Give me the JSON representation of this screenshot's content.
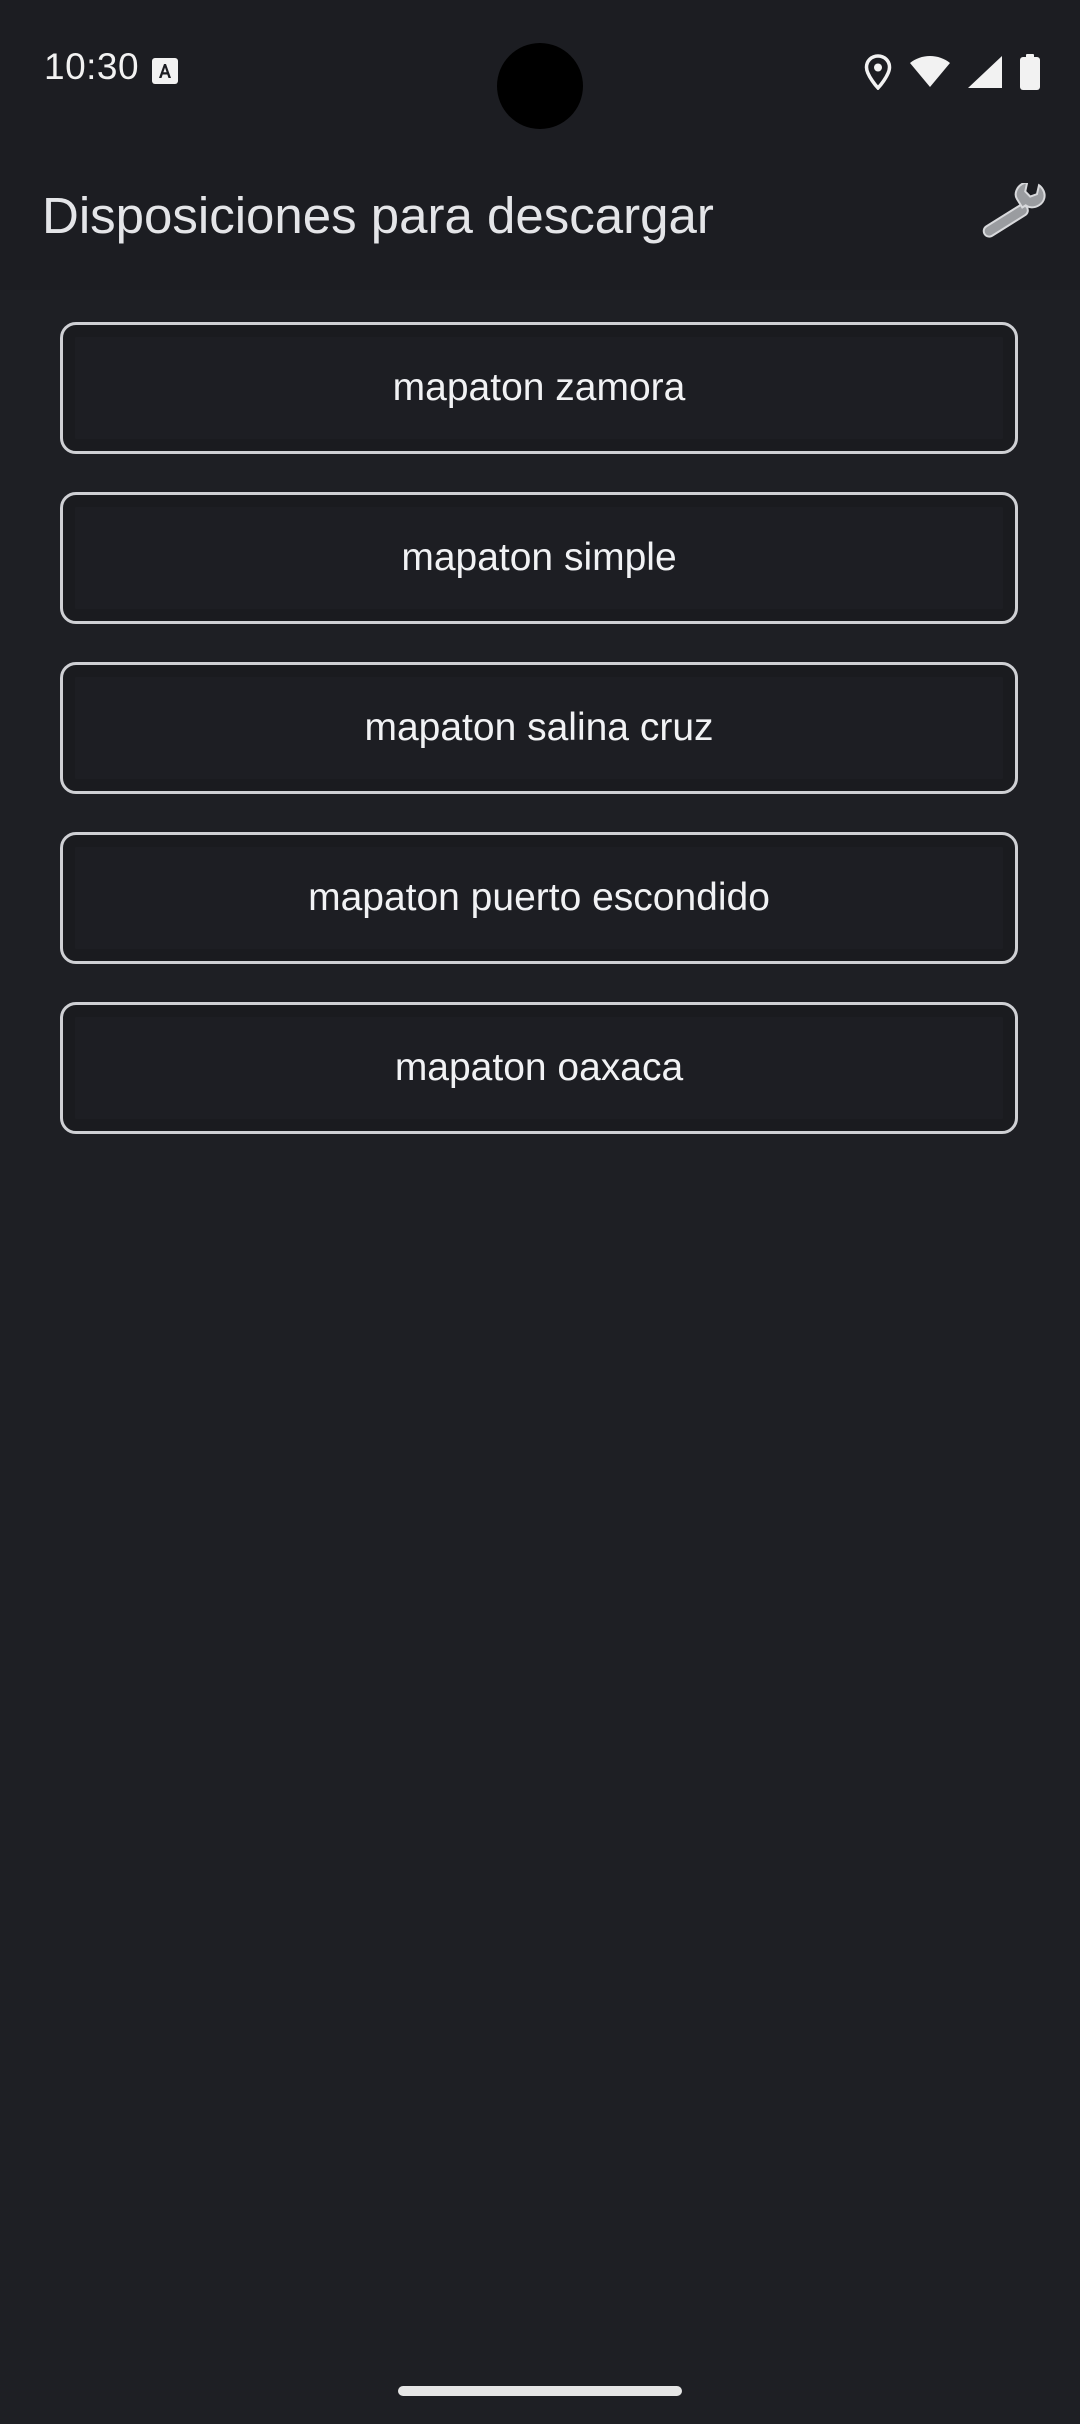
{
  "status_bar": {
    "time": "10:30",
    "icons": [
      "text-a-icon",
      "location-icon",
      "wifi-icon",
      "signal-icon",
      "battery-icon"
    ]
  },
  "app_bar": {
    "title": "Disposiciones para descargar",
    "settings_icon": "wrench-icon"
  },
  "layouts": [
    {
      "label": "mapaton zamora"
    },
    {
      "label": "mapaton simple"
    },
    {
      "label": "mapaton salina cruz"
    },
    {
      "label": "mapaton puerto escondido"
    },
    {
      "label": "mapaton oaxaca"
    }
  ],
  "colors": {
    "background": "#1e1f24",
    "bar_background": "#1c1d22",
    "text": "#f1f2f4",
    "button_border": "#cfd0d4"
  }
}
